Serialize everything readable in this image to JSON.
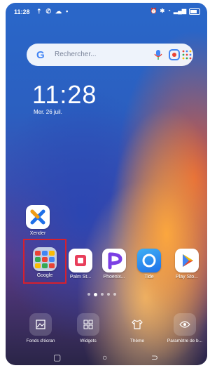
{
  "status_bar": {
    "time": "11:28",
    "left_icons": [
      "upload-icon",
      "whatsapp-icon",
      "bird-icon",
      "dot-icon"
    ],
    "right_icons": [
      "alarm-icon",
      "bluetooth-icon",
      "wifi-icon",
      "signal-icon",
      "battery-icon"
    ]
  },
  "search": {
    "placeholder": "Rechercher..."
  },
  "clock": {
    "time": "11:28",
    "date": "Mer. 26 juil."
  },
  "apps_row1": [
    {
      "label": "Xender",
      "color": "#ffffff"
    }
  ],
  "apps_row2": [
    {
      "label": "Google"
    },
    {
      "label": "Palm St..."
    },
    {
      "label": "Phoenix..."
    },
    {
      "label": "Tide"
    },
    {
      "label": "Play Sto..."
    }
  ],
  "page_indicator": {
    "pages": 5,
    "active": 1
  },
  "dock": [
    {
      "label": "Fonds d'écran"
    },
    {
      "label": "Widgets"
    },
    {
      "label": "Thème"
    },
    {
      "label": "Paramètre de b..."
    }
  ],
  "colors": {
    "highlight": "#d5202f",
    "google_blue": "#4285f4"
  }
}
